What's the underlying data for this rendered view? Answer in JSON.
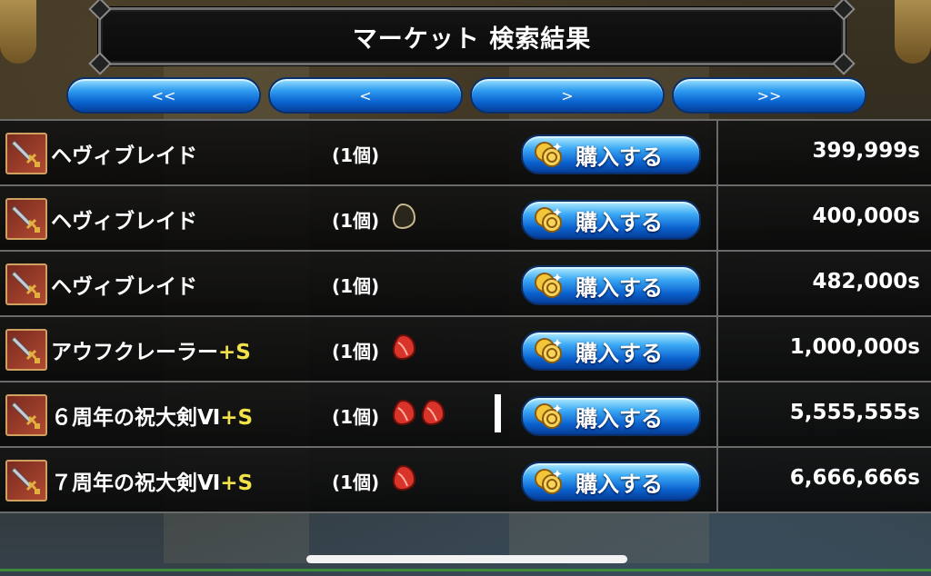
{
  "header": {
    "title": "マーケット 検索結果"
  },
  "nav": {
    "first": "<<",
    "prev": "<",
    "next": ">",
    "last": ">>"
  },
  "listings": [
    {
      "name": "ヘヴィブレイド",
      "suffix": "",
      "qty": "(1個)",
      "gems": [],
      "buy_label": "購入する",
      "price": "399,999s"
    },
    {
      "name": "ヘヴィブレイド",
      "suffix": "",
      "qty": "(1個)",
      "gems": [
        "empty"
      ],
      "buy_label": "購入する",
      "price": "400,000s"
    },
    {
      "name": "ヘヴィブレイド",
      "suffix": "",
      "qty": "(1個)",
      "gems": [],
      "buy_label": "購入する",
      "price": "482,000s"
    },
    {
      "name": "アウフクレーラー",
      "suffix": "+S",
      "qty": "(1個)",
      "gems": [
        "red"
      ],
      "buy_label": "購入する",
      "price": "1,000,000s"
    },
    {
      "name": "６周年の祝大剣Ⅵ",
      "suffix": "+S",
      "qty": "(1個)",
      "gems": [
        "red",
        "red"
      ],
      "buy_label": "購入する",
      "price": "5,555,555s"
    },
    {
      "name": "７周年の祝大剣Ⅵ",
      "suffix": "+S",
      "qty": "(1個)",
      "gems": [
        "red"
      ],
      "buy_label": "購入する",
      "price": "6,666,666s"
    }
  ],
  "icons": {
    "item": "sword-icon",
    "coin": "coin-icon",
    "gem": "gem-slot-icon"
  },
  "colors": {
    "accent_blue": "#2f9cf0",
    "suffix_yellow": "#f1e24a",
    "gem_red": "#d8342a"
  }
}
